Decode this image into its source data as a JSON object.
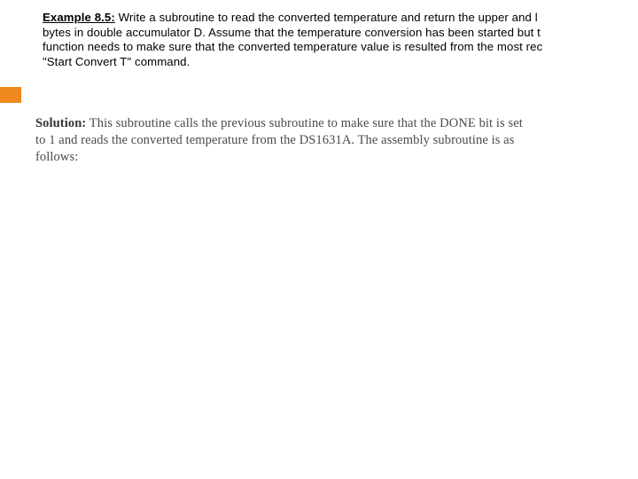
{
  "example": {
    "label": "Example 8.5:",
    "line1_rest": " Write a subroutine to read the converted temperature and return the upper and l",
    "line2": "bytes in double accumulator D. Assume that the temperature conversion has been started but t",
    "line3": "function needs to make sure that the converted temperature value is resulted from the most rec",
    "line4": "\"Start Convert T\" command."
  },
  "solution": {
    "label": "Solution:",
    "line1_rest": " This subroutine calls the previous subroutine to make sure that the DONE bit is set",
    "line2": "to 1 and reads the converted temperature from the DS1631A. The assembly subroutine is as",
    "line3": "follows:"
  }
}
